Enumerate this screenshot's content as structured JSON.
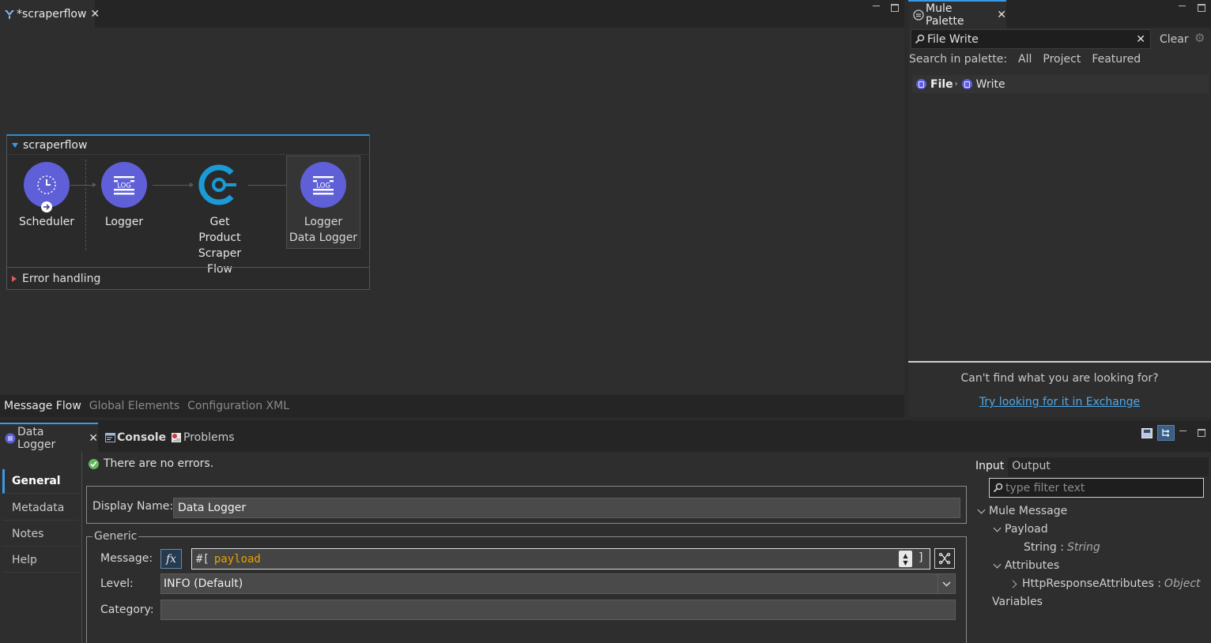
{
  "editor": {
    "tab_title": "*scraperflow",
    "flow_name": "scraperflow",
    "error_handling": "Error handling",
    "nodes": [
      {
        "label": "Scheduler",
        "icon": "clock-icon"
      },
      {
        "label": "Logger",
        "icon": "log-icon"
      },
      {
        "label": "Get\nProduct\nScraper Flow",
        "icon": "flow-reference-icon"
      },
      {
        "label": "Logger\nData Logger",
        "icon": "log-icon"
      }
    ],
    "bottom_tabs": [
      "Message Flow",
      "Global Elements",
      "Configuration XML"
    ]
  },
  "palette": {
    "tab_title": "Mule Palette",
    "search_value": "File Write",
    "clear_label": "Clear",
    "search_in_label": "Search in palette:",
    "filters": [
      "All",
      "Project",
      "Featured"
    ],
    "result_module": "File",
    "result_op": "Write",
    "help_text": "Can't find what you are looking for?",
    "exchange_link": "Try looking for it in Exchange"
  },
  "bottom": {
    "tabs": {
      "properties": "Data Logger",
      "console": "Console",
      "problems": "Problems"
    },
    "nav": [
      "General",
      "Metadata",
      "Notes",
      "Help"
    ],
    "status": "There are no errors.",
    "display_name_label": "Display Name:",
    "display_name_value": "Data Logger",
    "generic_label": "Generic",
    "message_label": "Message:",
    "message_prefix": "#[",
    "message_expr": "payload",
    "message_suffix": "]",
    "level_label": "Level:",
    "level_value": "INFO (Default)",
    "category_label": "Category:",
    "category_value": "",
    "io_tabs": [
      "Input",
      "Output"
    ],
    "filter_placeholder": "type filter text",
    "tree": {
      "root": "Mule Message",
      "payload": "Payload",
      "payload_type": "String :",
      "payload_type_val": "String",
      "attributes": "Attributes",
      "attr_type": "HttpResponseAttributes :",
      "attr_type_val": "Object",
      "variables": "Variables"
    }
  },
  "colors": {
    "accent": "#3b9ae5",
    "node": "#5f5fd8",
    "flowref": "#1a9bd6",
    "expression": "#e8a000",
    "link": "#4fa8e8"
  }
}
